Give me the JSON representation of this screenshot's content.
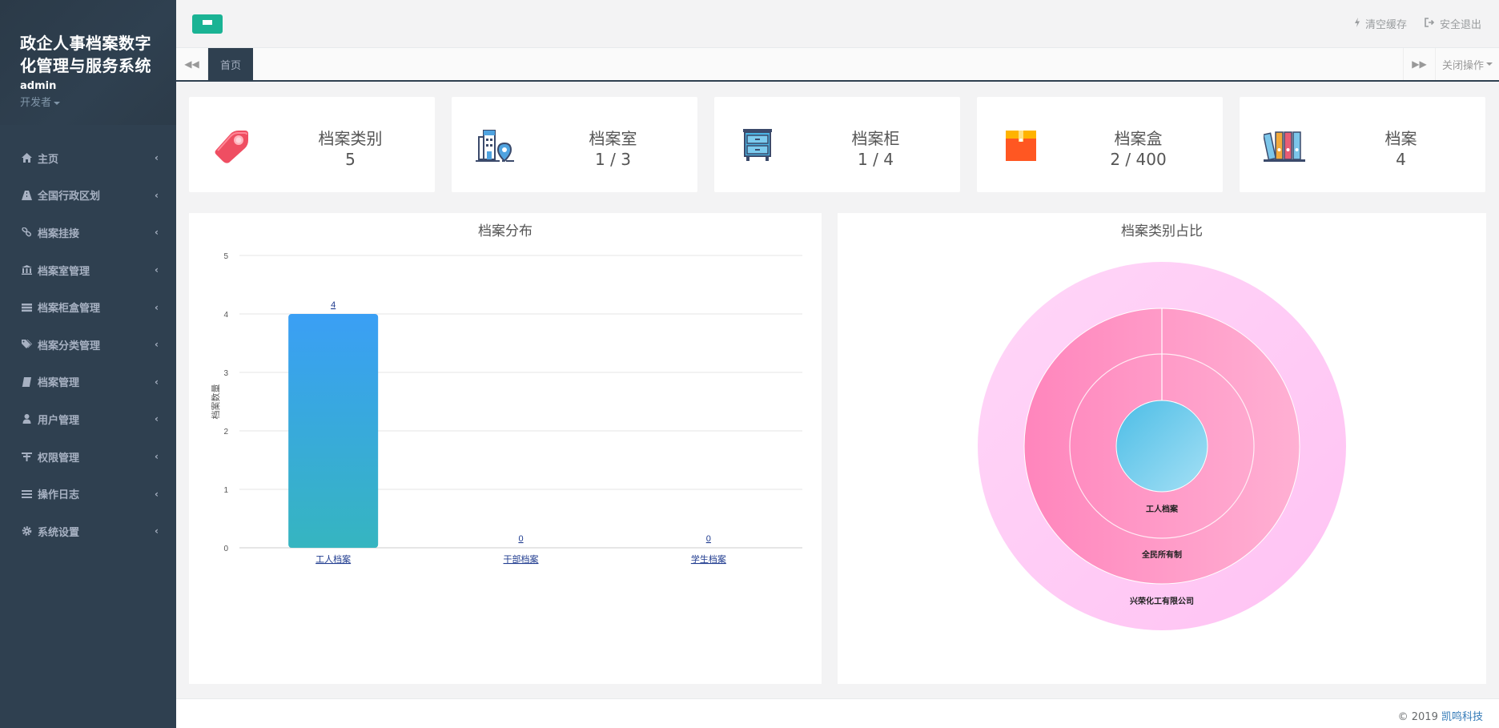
{
  "app": {
    "title": "政企人事档案数字化管理与服务系统",
    "user": "admin",
    "role": "开发者"
  },
  "sidebar": {
    "items": [
      {
        "label": "主页",
        "icon": "home-icon"
      },
      {
        "label": "全国行政区划",
        "icon": "road-icon"
      },
      {
        "label": "档案挂接",
        "icon": "link-icon"
      },
      {
        "label": "档案室管理",
        "icon": "bank-icon"
      },
      {
        "label": "档案柜盒管理",
        "icon": "list-icon"
      },
      {
        "label": "档案分类管理",
        "icon": "tags-icon"
      },
      {
        "label": "档案管理",
        "icon": "book-icon"
      },
      {
        "label": "用户管理",
        "icon": "user-icon"
      },
      {
        "label": "权限管理",
        "icon": "lock-icon"
      },
      {
        "label": "操作日志",
        "icon": "log-icon"
      },
      {
        "label": "系统设置",
        "icon": "gear-icon"
      }
    ]
  },
  "topbar": {
    "clear_cache": "清空缓存",
    "logout": "安全退出"
  },
  "tabs": {
    "active": "首页",
    "close_ops": "关闭操作"
  },
  "stats": [
    {
      "label": "档案类别",
      "value": "5",
      "icon": "tag-icon"
    },
    {
      "label": "档案室",
      "value": "1 / 3",
      "icon": "building-location-icon"
    },
    {
      "label": "档案柜",
      "value": "1 / 4",
      "icon": "cabinet-icon"
    },
    {
      "label": "档案盒",
      "value": "2 / 400",
      "icon": "box-icon"
    },
    {
      "label": "档案",
      "value": "4",
      "icon": "binders-icon"
    }
  ],
  "chart_data": [
    {
      "type": "bar",
      "title": "档案分布",
      "ylabel": "档案数量",
      "xlabel": "",
      "categories": [
        "工人档案",
        "干部档案",
        "学生档案"
      ],
      "values": [
        4,
        0,
        0
      ],
      "ylim": [
        0,
        5
      ],
      "yticks": [
        0,
        1,
        2,
        3,
        4,
        5
      ],
      "grid": true,
      "bar_gradient": [
        "#3a9ff5",
        "#36b5c0"
      ]
    },
    {
      "type": "pie",
      "title": "档案类别占比",
      "rings": [
        {
          "label": "工人档案",
          "value": 4,
          "color": "#5bc3e6"
        },
        {
          "label": "全民所有制",
          "value": 4,
          "color": "#ff8cc1"
        },
        {
          "label": "兴荣化工有限公司",
          "value": 4,
          "color": "#ffc8f5"
        }
      ]
    }
  ],
  "footer": {
    "copyright": "© 2019 ",
    "company": "凯鸣科技"
  }
}
